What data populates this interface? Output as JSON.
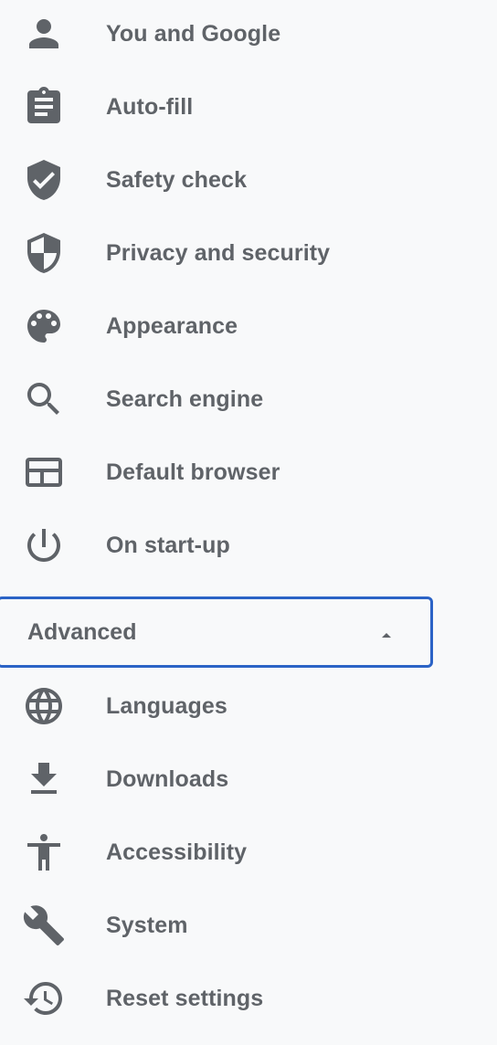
{
  "menu": {
    "items": [
      {
        "label": "You and Google",
        "icon": "person-icon"
      },
      {
        "label": "Auto-fill",
        "icon": "clipboard-icon"
      },
      {
        "label": "Safety check",
        "icon": "shield-check-icon"
      },
      {
        "label": "Privacy and security",
        "icon": "shield-half-icon"
      },
      {
        "label": "Appearance",
        "icon": "palette-icon"
      },
      {
        "label": "Search engine",
        "icon": "search-icon"
      },
      {
        "label": "Default browser",
        "icon": "browser-window-icon"
      },
      {
        "label": "On start-up",
        "icon": "power-icon"
      }
    ],
    "advanced": {
      "label": "Advanced",
      "expanded": true,
      "icon": "triangle-up-icon"
    },
    "advanced_items": [
      {
        "label": "Languages",
        "icon": "globe-icon"
      },
      {
        "label": "Downloads",
        "icon": "download-icon"
      },
      {
        "label": "Accessibility",
        "icon": "accessibility-icon"
      },
      {
        "label": "System",
        "icon": "wrench-icon"
      },
      {
        "label": "Reset settings",
        "icon": "restore-icon"
      }
    ]
  },
  "colors": {
    "text": "#5f6368",
    "icon": "#5f6368",
    "background": "#f8f9fa",
    "focus_outline": "#2b63c6"
  }
}
